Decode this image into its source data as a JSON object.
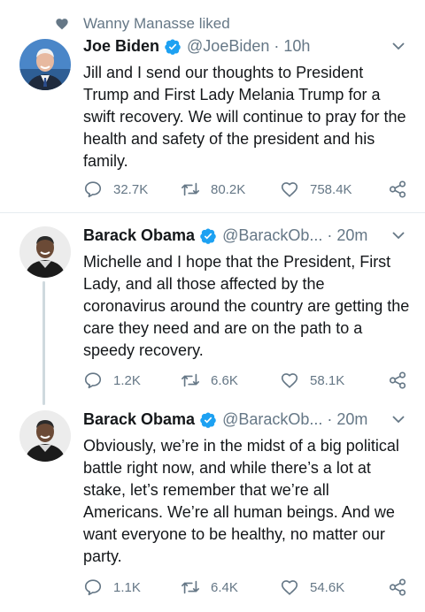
{
  "social_context": {
    "text": "Wanny Manasse liked",
    "icon": "heart-icon"
  },
  "tweets": [
    {
      "name": "Joe Biden",
      "handle": "@JoeBiden",
      "separator": "·",
      "time": "10h",
      "text": "Jill and I send our thoughts to President Trump and First Lady Melania Trump for a swift recovery. We will continue to pray for the health and safety of the president and his family.",
      "replies": "32.7K",
      "retweets": "80.2K",
      "likes": "758.4K"
    },
    {
      "name": "Barack Obama",
      "handle": "@BarackOb...",
      "separator": "·",
      "time": "20m",
      "text": "Michelle and I hope that the President, First Lady, and all those affected by the coronavirus around the country are getting the care they need and are on the path to a speedy recovery.",
      "replies": "1.2K",
      "retweets": "6.6K",
      "likes": "58.1K"
    },
    {
      "name": "Barack Obama",
      "handle": "@BarackOb...",
      "separator": "·",
      "time": "20m",
      "text": "Obviously, we’re in the midst of a big political battle right now, and while there’s a lot at stake, let’s remember that we’re all Americans. We’re all human beings. And we want everyone to be healthy, no matter our party.",
      "replies": "1.1K",
      "retweets": "6.4K",
      "likes": "54.6K"
    }
  ],
  "colors": {
    "verified": "#1da1f2",
    "secondary_text": "#657786",
    "primary_text": "#14171a"
  }
}
